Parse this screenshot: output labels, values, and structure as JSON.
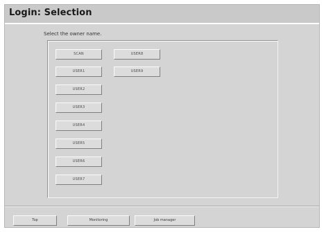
{
  "window": {
    "title": "Login: Selection"
  },
  "main": {
    "instruction": "Select the owner name.",
    "user_buttons": [
      "SCAN",
      "USER1",
      "USER2",
      "USER3",
      "USER4",
      "USER5",
      "USER6",
      "USER7",
      "USER8",
      "USER9"
    ]
  },
  "footer": {
    "top_label": "Top",
    "monitoring_label": "Monitoring",
    "job_manager_label": "Job manager"
  },
  "colors": {
    "background": "#d4d4d4",
    "title_bar": "#c9c9c9",
    "button_face": "#dcdcdc"
  }
}
